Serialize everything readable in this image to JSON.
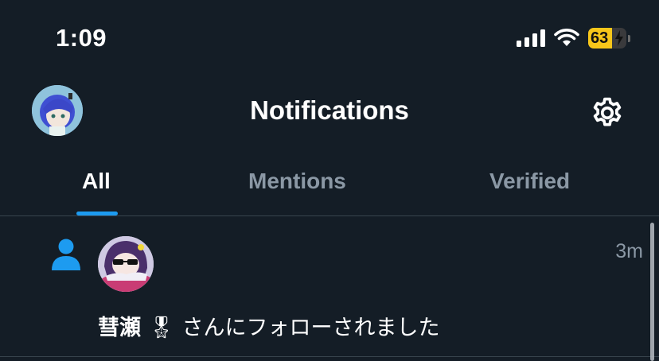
{
  "status_bar": {
    "time": "1:09",
    "battery_percent": 63,
    "battery_label": "63",
    "battery_charging": true,
    "signal_icon": "cellular-signal-icon",
    "wifi_icon": "wifi-icon"
  },
  "header": {
    "title": "Notifications",
    "avatar_icon": "profile-avatar",
    "settings_icon": "gear-icon"
  },
  "tabs": [
    {
      "label": "All",
      "active": true
    },
    {
      "label": "Mentions",
      "active": false
    },
    {
      "label": "Verified",
      "active": false
    }
  ],
  "notifications": [
    {
      "type_icon": "person-icon",
      "time": "3m",
      "user_name": "彗瀬",
      "emoji": "🎖",
      "message": "さんにフォローされました"
    }
  ],
  "colors": {
    "background": "#141d26",
    "accent": "#1d9bf0",
    "muted_text": "#8b98a5",
    "battery": "#f7c61a"
  }
}
